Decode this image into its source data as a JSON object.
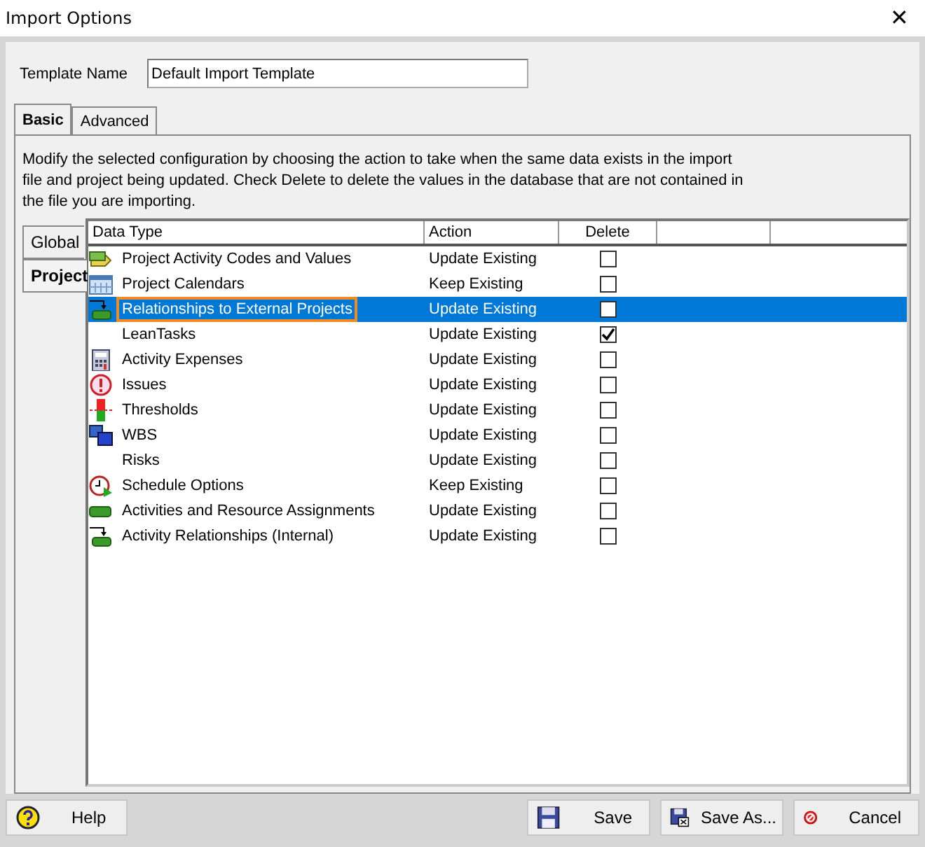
{
  "window": {
    "title": "Import Options",
    "close": "✕"
  },
  "template_name": {
    "label": "Template Name",
    "value": "Default Import Template"
  },
  "tabs": [
    {
      "label": "Basic",
      "selected": true
    },
    {
      "label": "Advanced",
      "selected": false
    }
  ],
  "description": "Modify the selected configuration by choosing the action to take when the same data exists in the import file and project being updated. Check Delete  to delete the values in the database that are not contained in the file you are importing.",
  "side_tabs": [
    {
      "label": "Global",
      "selected": false
    },
    {
      "label": "Project",
      "selected": true
    }
  ],
  "table": {
    "columns": [
      "Data Type",
      "Action",
      "Delete"
    ],
    "rows": [
      {
        "data_type": "Project Activity Codes and Values",
        "action": "Update Existing",
        "delete": false,
        "selected": false
      },
      {
        "data_type": "Project Calendars",
        "action": "Keep Existing",
        "delete": false,
        "selected": false
      },
      {
        "data_type": "Relationships to External Projects",
        "action": "Update Existing",
        "delete": false,
        "selected": true
      },
      {
        "data_type": "LeanTasks",
        "action": "Update Existing",
        "delete": true,
        "selected": false
      },
      {
        "data_type": "Activity Expenses",
        "action": "Update Existing",
        "delete": false,
        "selected": false
      },
      {
        "data_type": "Issues",
        "action": "Update Existing",
        "delete": false,
        "selected": false
      },
      {
        "data_type": "Thresholds",
        "action": "Update Existing",
        "delete": false,
        "selected": false
      },
      {
        "data_type": "WBS",
        "action": "Update Existing",
        "delete": false,
        "selected": false
      },
      {
        "data_type": "Risks",
        "action": "Update Existing",
        "delete": false,
        "selected": false
      },
      {
        "data_type": "Schedule Options",
        "action": "Keep Existing",
        "delete": false,
        "selected": false
      },
      {
        "data_type": "Activities and Resource Assignments",
        "action": "Update Existing",
        "delete": false,
        "selected": false
      },
      {
        "data_type": "Activity Relationships (Internal)",
        "action": "Update Existing",
        "delete": false,
        "selected": false
      }
    ]
  },
  "buttons": [
    {
      "label": "Help"
    },
    {
      "label": "Save"
    },
    {
      "label": "Save As..."
    },
    {
      "label": "Cancel"
    }
  ]
}
